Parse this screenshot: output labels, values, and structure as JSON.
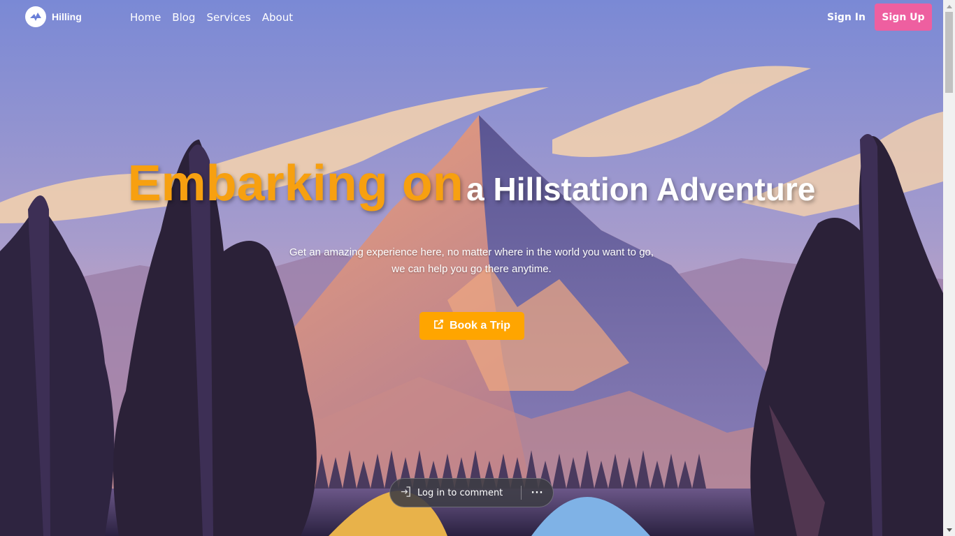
{
  "brand": {
    "name": "Hilling",
    "logo_icon": "bolt-logo-icon"
  },
  "nav": {
    "items": [
      {
        "label": "Home"
      },
      {
        "label": "Blog"
      },
      {
        "label": "Services"
      },
      {
        "label": "About"
      }
    ],
    "sign_in": "Sign In",
    "sign_up": "Sign Up"
  },
  "hero": {
    "title_accent": "Embarking on",
    "title_rest": "a Hillstation Adventure",
    "subtitle_line1": "Get an amazing experience here, no matter where in the world you want to go,",
    "subtitle_line2": "we can help you go there anytime.",
    "cta_label": "Book a Trip",
    "cta_icon": "external-link-icon"
  },
  "comment_bar": {
    "login_label": "Log in to comment",
    "login_icon": "login-icon",
    "more_label": "···"
  },
  "colors": {
    "accent": "#ffa500",
    "title_accent": "#f7a010",
    "signup": "#ee5fa0",
    "sky": "#7b8ad6"
  }
}
